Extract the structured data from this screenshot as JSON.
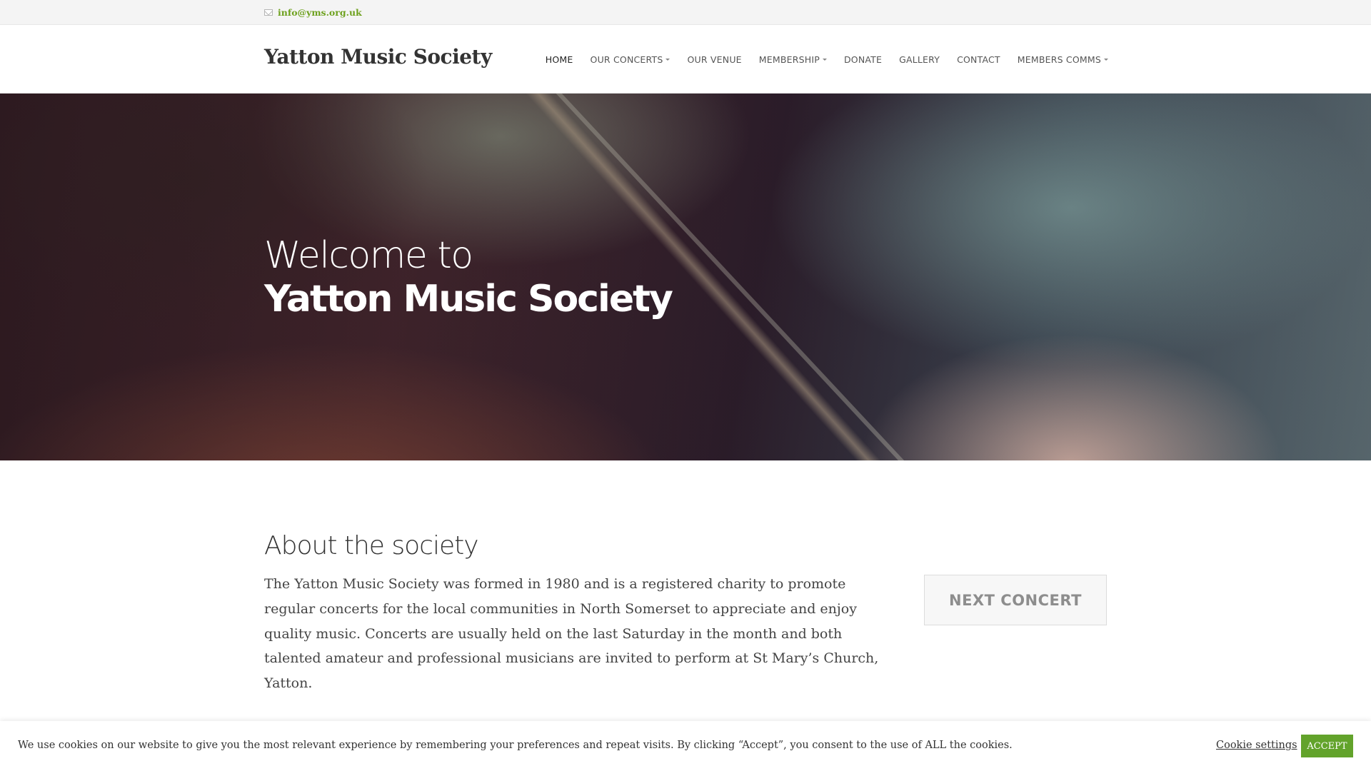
{
  "topbar": {
    "email": "info@yms.org.uk",
    "email_icon": "mail-icon"
  },
  "header": {
    "logo": "Yatton Music Society"
  },
  "nav": {
    "items": [
      {
        "label": "HOME",
        "active": true,
        "has_dropdown": false
      },
      {
        "label": "OUR CONCERTS",
        "active": false,
        "has_dropdown": true
      },
      {
        "label": "OUR VENUE",
        "active": false,
        "has_dropdown": false
      },
      {
        "label": "MEMBERSHIP",
        "active": false,
        "has_dropdown": true
      },
      {
        "label": "DONATE",
        "active": false,
        "has_dropdown": false
      },
      {
        "label": "GALLERY",
        "active": false,
        "has_dropdown": false
      },
      {
        "label": "CONTACT",
        "active": false,
        "has_dropdown": false
      },
      {
        "label": "MEMBERS COMMS",
        "active": false,
        "has_dropdown": true
      }
    ]
  },
  "hero": {
    "line1": "Welcome to",
    "line2": "Yatton Music Society"
  },
  "about": {
    "title": "About the society",
    "body": "The Yatton Music Society was formed in 1980 and is a registered charity to promote regular concerts for the local communities in North Somerset to appreciate and enjoy quality music. Concerts are usually held on the last Saturday in the month and both talented amateur and professional musicians are invited to perform at St Mary’s Church, Yatton."
  },
  "sidebar": {
    "next_concert_label": "NEXT CONCERT"
  },
  "cookie": {
    "message": "We use cookies on our website to give you the most relevant experience by remembering your preferences and repeat visits. By clicking “Accept”, you consent to the use of ALL the cookies.",
    "settings_label": "Cookie settings",
    "accept_label": "ACCEPT"
  },
  "colors": {
    "accent_green": "#62a32b",
    "email_green": "#6ea11e",
    "text_dark": "#333333"
  }
}
